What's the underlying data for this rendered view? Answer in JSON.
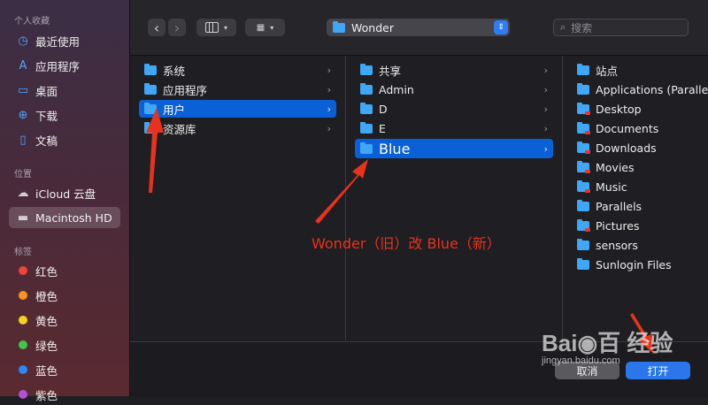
{
  "sidebar": {
    "favorites_heading": "个人收藏",
    "favorites": [
      {
        "label": "最近使用",
        "icon": "clock-icon"
      },
      {
        "label": "应用程序",
        "icon": "applications-icon"
      },
      {
        "label": "桌面",
        "icon": "desktop-icon"
      },
      {
        "label": "下载",
        "icon": "download-icon"
      },
      {
        "label": "文稿",
        "icon": "document-icon"
      }
    ],
    "locations_heading": "位置",
    "locations": [
      {
        "label": "iCloud 云盘",
        "icon": "cloud-icon"
      },
      {
        "label": "Macintosh HD",
        "icon": "disk-icon",
        "selected": true
      }
    ],
    "tags_heading": "标签",
    "tags": [
      {
        "label": "红色",
        "color": "#f2433b"
      },
      {
        "label": "橙色",
        "color": "#f7941e"
      },
      {
        "label": "黄色",
        "color": "#f7d11e"
      },
      {
        "label": "绿色",
        "color": "#3ec74a"
      },
      {
        "label": "蓝色",
        "color": "#2f86f6"
      },
      {
        "label": "紫色",
        "color": "#b152d8"
      }
    ]
  },
  "toolbar": {
    "back": "‹",
    "forward": "›",
    "view_column_icon": "column-view-icon",
    "view_grid_icon": "grid-view-icon",
    "location": "Wonder",
    "search_placeholder": "搜索"
  },
  "columns": {
    "col1": [
      {
        "name": "系统"
      },
      {
        "name": "应用程序"
      },
      {
        "name": "用户",
        "selected": true
      },
      {
        "name": "资源库"
      }
    ],
    "col2": [
      {
        "name": "共享"
      },
      {
        "name": "Admin"
      },
      {
        "name": "D"
      },
      {
        "name": "E"
      },
      {
        "name": "Blue",
        "selected": true
      }
    ],
    "col3": [
      "站点",
      "Applications (Parallels)",
      "Desktop",
      "Documents",
      "Downloads",
      "Movies",
      "Music",
      "Parallels",
      "Pictures",
      "sensors",
      "Sunlogin Files"
    ]
  },
  "buttons": {
    "cancel": "取消",
    "open": "打开"
  },
  "annotation": "Wonder（旧）改 Blue（新）",
  "watermark": {
    "main": "Bai◉百 经验",
    "sub": "jingyan.baidu.com"
  },
  "colors": {
    "accent": "#0a60d6",
    "annotation_red": "#e8321e"
  }
}
